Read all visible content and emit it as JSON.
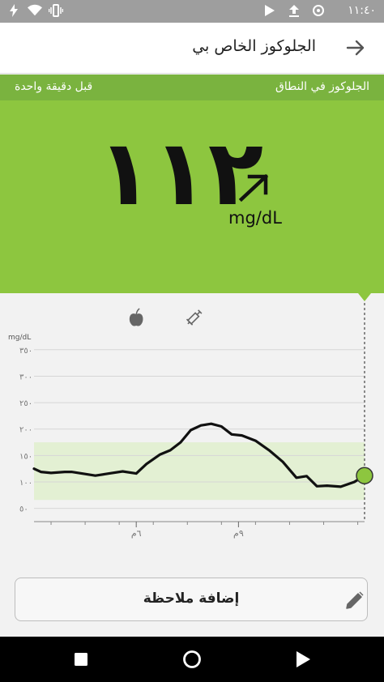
{
  "status_bar": {
    "time": "١١:٤٠",
    "icons": [
      "flash-icon",
      "wifi-icon",
      "vibrate-icon",
      "play-store-icon",
      "upload-icon",
      "data-saver-icon",
      "battery-icon"
    ]
  },
  "app_bar": {
    "title": "الجلوكوز الخاص بي",
    "back_icon": "arrow-right-icon"
  },
  "status_stripe": {
    "range_text": "الجلوكوز في النطاق",
    "time_text": "قبل دقيقة واحدة",
    "color": "#7ab33f"
  },
  "reading": {
    "value": "١١٢",
    "unit": "mg/dL",
    "trend_icon": "trend-up-right-arrow-icon",
    "background_color": "#8dc63f"
  },
  "events": [
    {
      "icon": "apple-icon",
      "label": "meal",
      "x": 6.0
    },
    {
      "icon": "syringe-icon",
      "label": "insulin",
      "x": 7.7
    }
  ],
  "chart_data": {
    "type": "line",
    "ylabel": "mg/dL",
    "yticks": [
      {
        "value": 50,
        "label": "٥٠"
      },
      {
        "value": 100,
        "label": "١٠٠"
      },
      {
        "value": 150,
        "label": "١٥٠"
      },
      {
        "value": 200,
        "label": "٢٠٠"
      },
      {
        "value": 250,
        "label": "٢٥٠"
      },
      {
        "value": 300,
        "label": "٣٠٠"
      },
      {
        "value": 350,
        "label": "٣٥٠"
      }
    ],
    "xticks": [
      {
        "value": 6,
        "label": "٦م"
      },
      {
        "value": 9,
        "label": "٩م"
      }
    ],
    "xlim": [
      3.0,
      11.1
    ],
    "ylim": [
      25,
      365
    ],
    "target_range": [
      66,
      175
    ],
    "series": [
      {
        "color": "#111111",
        "points": [
          [
            3.0,
            125
          ],
          [
            3.2,
            119
          ],
          [
            3.5,
            117
          ],
          [
            3.9,
            119
          ],
          [
            4.1,
            119
          ],
          [
            4.5,
            115
          ],
          [
            4.8,
            112
          ],
          [
            5.2,
            116
          ],
          [
            5.6,
            120
          ],
          [
            6.0,
            116
          ],
          [
            6.3,
            134
          ],
          [
            6.7,
            152
          ],
          [
            7.0,
            160
          ],
          [
            7.3,
            175
          ],
          [
            7.6,
            198
          ],
          [
            7.9,
            207
          ],
          [
            8.2,
            210
          ],
          [
            8.5,
            205
          ],
          [
            8.8,
            190
          ],
          [
            9.1,
            188
          ],
          [
            9.5,
            178
          ],
          [
            9.9,
            160
          ],
          [
            10.3,
            138
          ],
          [
            10.7,
            108
          ],
          [
            11.0,
            111
          ],
          [
            11.3,
            92
          ],
          [
            11.6,
            93
          ],
          [
            12.0,
            91
          ],
          [
            12.4,
            100
          ],
          [
            12.7,
            112
          ]
        ]
      }
    ],
    "current_point": {
      "x": 12.7,
      "y": 112,
      "color": "#8dc63f"
    },
    "plot_x_range": [
      3.0,
      12.7
    ]
  },
  "add_note": {
    "label": "إضافة ملاحظة",
    "icon": "pencil-icon"
  },
  "nav_bar": {
    "buttons": [
      "recents-square-icon",
      "home-circle-icon",
      "back-triangle-icon"
    ]
  }
}
